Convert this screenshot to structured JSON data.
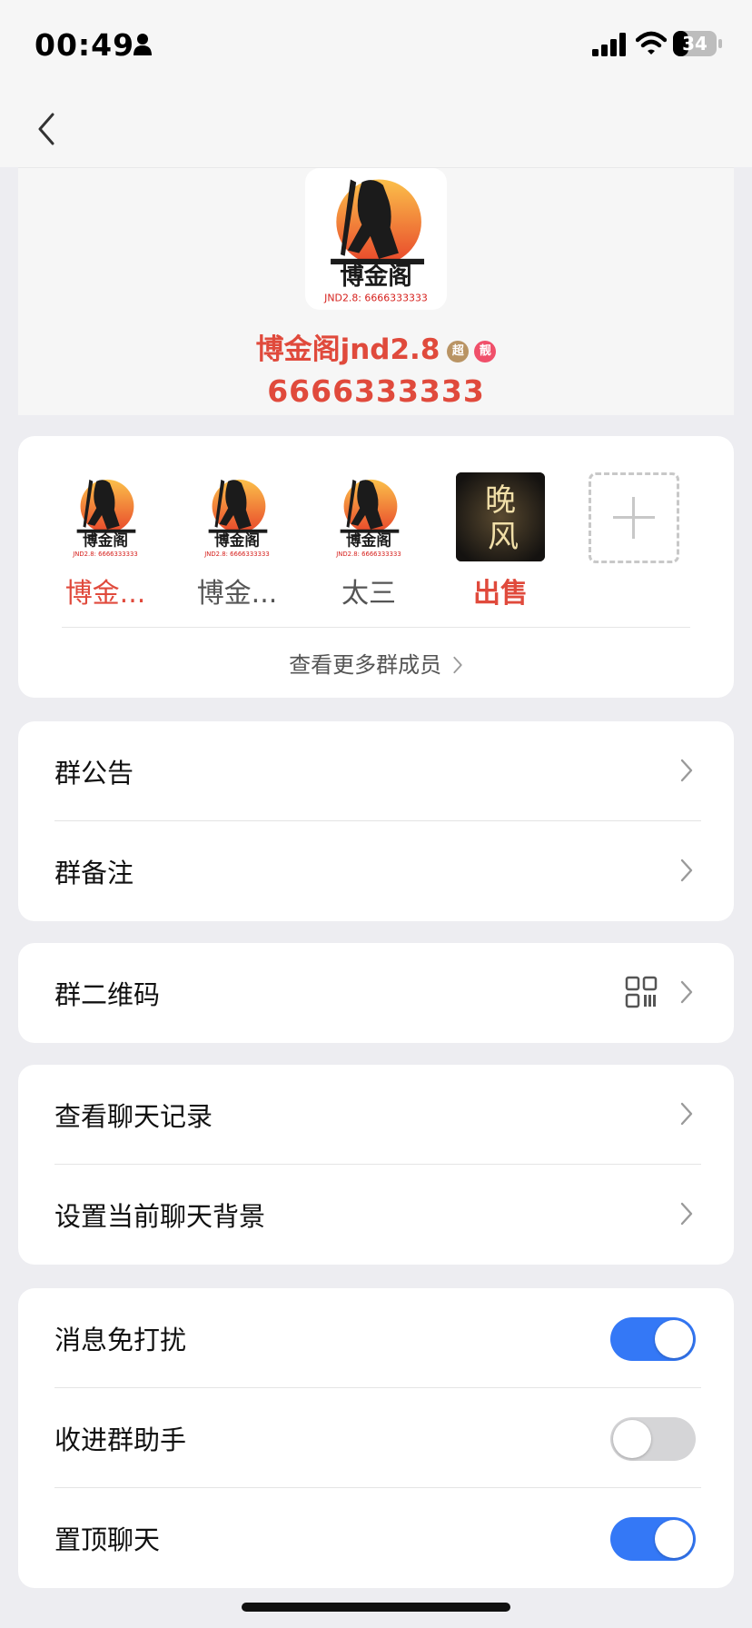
{
  "status": {
    "time": "00:49",
    "battery": "34"
  },
  "header": {
    "group_name": "博金阁jnd2.8",
    "badge_1": "超",
    "badge_2": "靓",
    "group_id": "6666333333",
    "avatar_title": "博金阁",
    "avatar_caption": "JND2.8: 6666333333"
  },
  "members": {
    "items": [
      {
        "name": "博金...",
        "color": "#E04A3C"
      },
      {
        "name": "博金...",
        "color": "#555555"
      },
      {
        "name": "太三",
        "color": "#555555"
      },
      {
        "name": "出售",
        "color": "#E04A3C"
      }
    ],
    "more_label": "查看更多群成员",
    "dark_avatar_text": "晚风"
  },
  "settings": {
    "announcement": "群公告",
    "remark": "群备注",
    "qrcode": "群二维码",
    "history": "查看聊天记录",
    "background": "设置当前聊天背景",
    "dnd": {
      "label": "消息免打扰",
      "on": true
    },
    "assistant": {
      "label": "收进群助手",
      "on": false
    },
    "pin": {
      "label": "置顶聊天",
      "on": true
    }
  },
  "colors": {
    "accent_red": "#E04A3C",
    "toggle_on": "#3478F6",
    "toggle_off": "#D5D5D7"
  }
}
